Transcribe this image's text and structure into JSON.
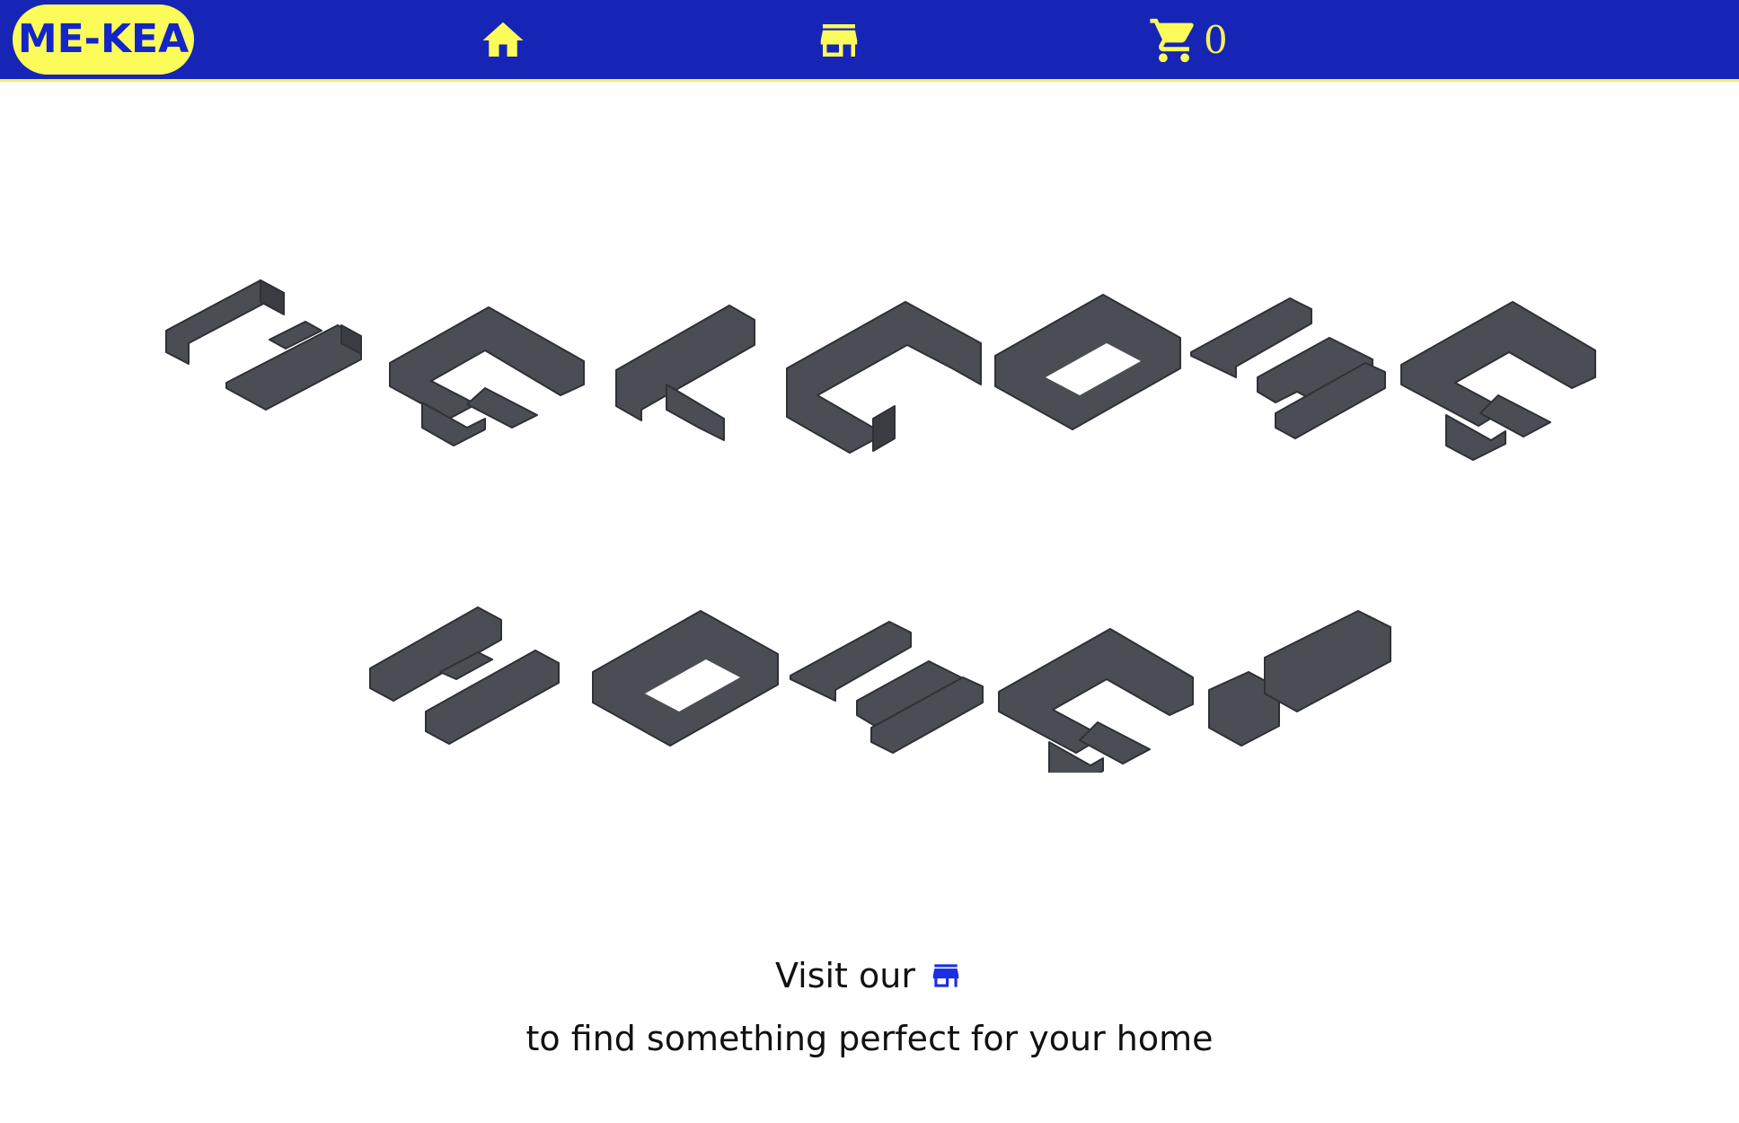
{
  "nav": {
    "logo_text": "ME-KEA",
    "home_icon": "home-icon",
    "store_icon": "store-icon",
    "cart_icon": "cart-icon",
    "cart_count": "0"
  },
  "hero": {
    "heading_words": [
      "WELCOME",
      "HOME!"
    ],
    "style": "letters built from grey modular sofa sections"
  },
  "message": {
    "line1": "Visit our",
    "line1_icon": "store-icon",
    "line2": "to find something perfect for your home"
  },
  "colors": {
    "nav_bg": "#1625b6",
    "accent_yellow": "#fbfb5a",
    "logo_text": "#1324c8",
    "inline_icon": "#1c2ee0",
    "sofa_grey": "#4a4d53"
  }
}
